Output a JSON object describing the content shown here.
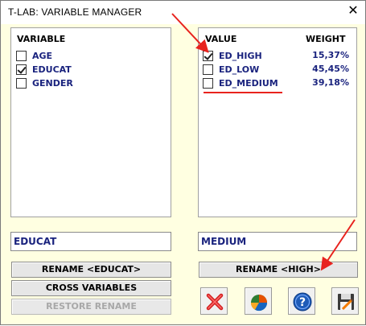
{
  "window": {
    "title": "T-LAB: VARIABLE MANAGER",
    "close_symbol": "✕"
  },
  "variables": {
    "header": "VARIABLE",
    "items": [
      {
        "label": "AGE",
        "checked": false
      },
      {
        "label": "EDUCAT",
        "checked": true
      },
      {
        "label": "GENDER",
        "checked": false
      }
    ]
  },
  "values": {
    "header_value": "VALUE",
    "header_weight": "WEIGHT",
    "items": [
      {
        "label": "ED_HIGH",
        "weight": "15,37%",
        "checked": true
      },
      {
        "label": "ED_LOW",
        "weight": "45,45%",
        "checked": false
      },
      {
        "label": "ED_MEDIUM",
        "weight": "39,18%",
        "checked": false
      }
    ]
  },
  "inputs": {
    "variable_name": "EDUCAT",
    "value_name": "MEDIUM"
  },
  "buttons": {
    "rename_variable": "RENAME <EDUCAT>",
    "cross_variables": "CROSS VARIABLES",
    "restore_rename": "RESTORE RENAME",
    "rename_value": "RENAME <HIGH>"
  },
  "icons": [
    "delete-icon",
    "pie-chart-icon",
    "help-icon",
    "save-icon"
  ],
  "colors": {
    "background": "#ffffe1",
    "label_text": "#1a237e",
    "annotation_red": "#e8231e"
  }
}
